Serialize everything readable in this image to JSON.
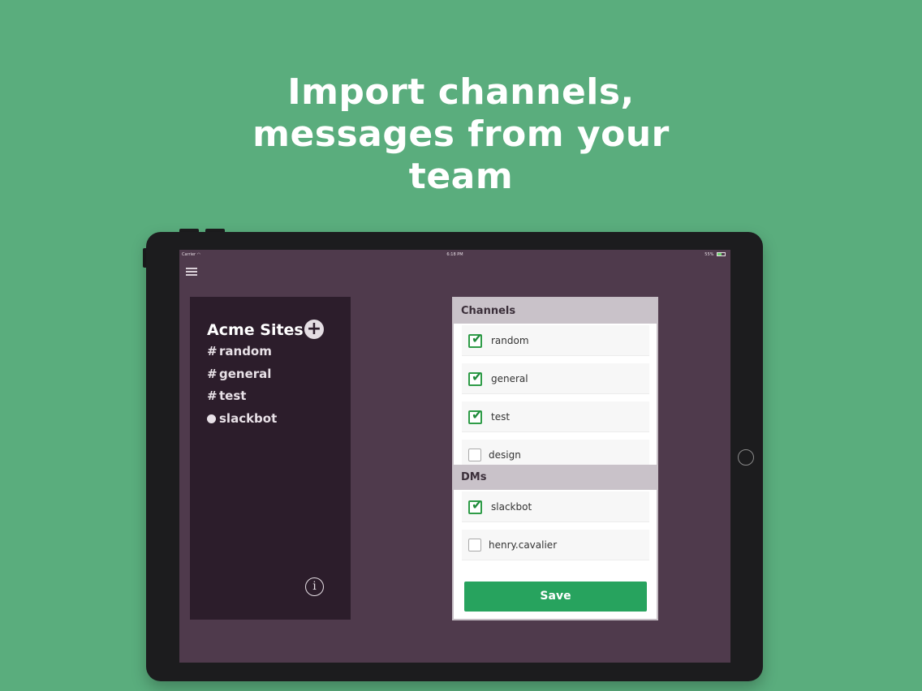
{
  "headline": {
    "line1": "Import channels,",
    "line2": "messages from your",
    "line3": "team"
  },
  "statusbar": {
    "carrier": "Carrier",
    "time": "6:18 PM",
    "battery": "55%",
    "battery_level": 0.55
  },
  "sidebar": {
    "team_name": "Acme Sites",
    "add_symbol": "+",
    "info_symbol": "i",
    "items": [
      {
        "prefix": "#",
        "label": "random"
      },
      {
        "prefix": "#",
        "label": "general"
      },
      {
        "prefix": "#",
        "label": "test"
      },
      {
        "prefix": "dot",
        "label": "slackbot"
      }
    ]
  },
  "panel": {
    "channels_header": "Channels",
    "channels": [
      {
        "label": "random",
        "checked": true
      },
      {
        "label": "general",
        "checked": true
      },
      {
        "label": "test",
        "checked": true
      },
      {
        "label": "design",
        "checked": false
      }
    ],
    "dms_header": "DMs",
    "dms": [
      {
        "label": "slackbot",
        "checked": true
      },
      {
        "label": "henry.cavalier",
        "checked": false
      }
    ],
    "save_label": "Save"
  },
  "colors": {
    "background": "#5aad7d",
    "screen": "#4f3a4c",
    "sidebar": "#2c1d2b",
    "accent_green": "#27a35e",
    "check_green": "#2f9c48"
  }
}
